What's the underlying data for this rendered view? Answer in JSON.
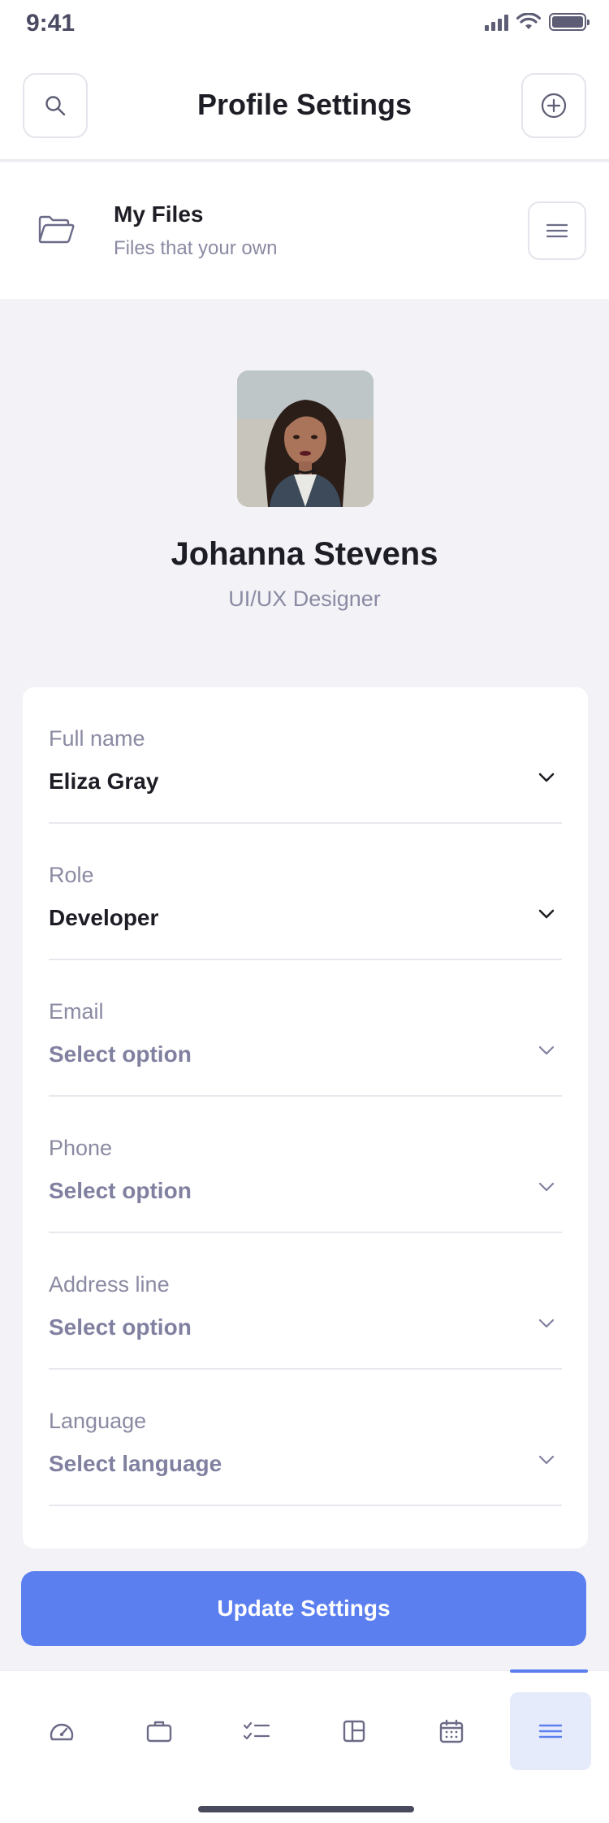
{
  "status_bar": {
    "time": "9:41"
  },
  "header": {
    "title": "Profile Settings"
  },
  "files": {
    "title": "My Files",
    "subtitle": "Files that your own"
  },
  "profile": {
    "name": "Johanna Stevens",
    "role": "UI/UX Designer"
  },
  "form": {
    "fields": [
      {
        "label": "Full name",
        "value": "Eliza Gray",
        "filled": true
      },
      {
        "label": "Role",
        "value": "Developer",
        "filled": true
      },
      {
        "label": "Email",
        "value": "Select option",
        "filled": false
      },
      {
        "label": "Phone",
        "value": "Select option",
        "filled": false
      },
      {
        "label": "Address line",
        "value": "Select option",
        "filled": false
      },
      {
        "label": "Language",
        "value": "Select language",
        "filled": false
      }
    ]
  },
  "actions": {
    "update_label": "Update Settings"
  },
  "nav": {
    "items": [
      {
        "icon": "dashboard-icon"
      },
      {
        "icon": "briefcase-icon"
      },
      {
        "icon": "checklist-icon"
      },
      {
        "icon": "layout-icon"
      },
      {
        "icon": "calendar-icon"
      },
      {
        "icon": "menu-icon",
        "active": true
      }
    ]
  },
  "colors": {
    "accent": "#5c7ff0",
    "muted": "#8a8aa3",
    "text": "#1d1d25"
  }
}
